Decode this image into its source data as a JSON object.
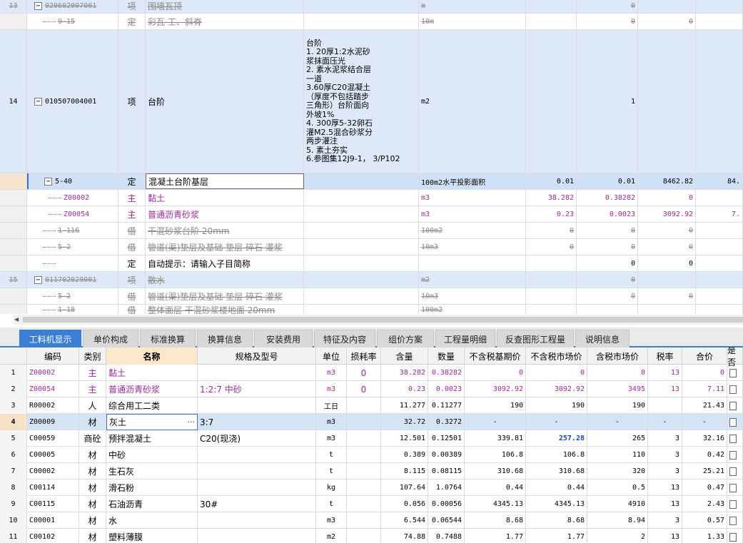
{
  "top_rows": [
    {
      "rownum": "13",
      "code": "020602007001",
      "type": "项",
      "name": "围墙瓦顶",
      "desc": "",
      "unit": "m",
      "q1": "",
      "q2": "0",
      "price": "",
      "total": "",
      "style": "strike",
      "bg": "blue",
      "toggle": "minus",
      "indent": 0
    },
    {
      "rownum": "",
      "code": "9-15",
      "type": "定",
      "name": "彩瓦 工、斜脊",
      "desc": "",
      "unit": "10m",
      "q1": "",
      "q2": "0",
      "price": "0",
      "total": "",
      "style": "strike",
      "bg": "white",
      "toggle": "none",
      "indent": 1
    },
    {
      "rownum": "14",
      "code": "010507004001",
      "type": "项",
      "name": "台阶",
      "desc": "台阶\n1. 20厚1:2水泥砂\n浆抹面压光\n2. 素水泥浆结合层\n一道\n3.60厚C20混凝土\n（厚度不包括踏步\n三角形）台阶面向\n外坡1%\n4. 300厚5-32卵石\n灌M2.5混合砂浆分\n两步灌注\n5. 素土夯实\n6.参图集12J9-1， 3/P102",
      "unit": "m2",
      "q1": "",
      "q2": "1",
      "price": "",
      "total": "",
      "style": "normal",
      "bg": "blue",
      "toggle": "minus",
      "indent": 0
    },
    {
      "rownum": "",
      "code": "5-40",
      "type": "定",
      "name": "混凝土台阶基层",
      "desc": "",
      "unit": "100m2水平投影面积",
      "q1": "0.01",
      "q2": "0.01",
      "price": "8462.82",
      "total": "84.",
      "style": "normal",
      "bg": "sel",
      "toggle": "minus",
      "indent": 1
    },
    {
      "rownum": "",
      "code": "Z00002",
      "type": "主",
      "name": "黏土",
      "desc": "",
      "unit": "m3",
      "q1": "38.282",
      "q2": "0.38282",
      "price": "0",
      "total": "",
      "style": "purple",
      "bg": "white",
      "toggle": "none",
      "indent": 2
    },
    {
      "rownum": "",
      "code": "Z00054",
      "type": "主",
      "name": "普通沥青砂浆",
      "desc": "",
      "unit": "m3",
      "q1": "0.23",
      "q2": "0.0023",
      "price": "3092.92",
      "total": "7.",
      "style": "purple",
      "bg": "white",
      "toggle": "none",
      "indent": 2
    },
    {
      "rownum": "",
      "code": "1-116",
      "type": "借",
      "name": "干混砂浆台阶 20mm",
      "desc": "",
      "unit": "100m2",
      "q1": "0",
      "q2": "0",
      "price": "0",
      "total": "",
      "style": "strike",
      "bg": "white",
      "toggle": "none",
      "indent": 1
    },
    {
      "rownum": "",
      "code": "5-2",
      "type": "借",
      "name": "管道(渠)垫层及基础 垫层 碎石 灌浆",
      "desc": "",
      "unit": "10m3",
      "q1": "0",
      "q2": "0",
      "price": "0",
      "total": "",
      "style": "strike",
      "bg": "white",
      "toggle": "none",
      "indent": 1
    },
    {
      "rownum": "",
      "code": "",
      "type": "定",
      "name": "自动提示：请输入子目简称",
      "desc": "",
      "unit": "",
      "q1": "",
      "q2": "0",
      "price": "0",
      "total": "",
      "style": "normal",
      "bg": "white",
      "toggle": "none",
      "indent": 1
    },
    {
      "rownum": "15",
      "code": "011702029001",
      "type": "项",
      "name": "散水",
      "desc": "",
      "unit": "m2",
      "q1": "",
      "q2": "0",
      "price": "",
      "total": "",
      "style": "strike",
      "bg": "blue",
      "toggle": "minus",
      "indent": 0
    },
    {
      "rownum": "",
      "code": "5-2",
      "type": "借",
      "name": "管道(渠)垫层及基础 垫层 碎石 灌浆",
      "desc": "",
      "unit": "10m3",
      "q1": "",
      "q2": "0",
      "price": "0",
      "total": "",
      "style": "strike",
      "bg": "white",
      "toggle": "none",
      "indent": 1
    },
    {
      "rownum": "",
      "code": "1-18",
      "type": "借",
      "name": "整体面层 干混砂浆楼地面 20mm",
      "desc": "",
      "unit": "100m2",
      "q1": "",
      "q2": "",
      "price": "",
      "total": "",
      "style": "strike",
      "bg": "white",
      "toggle": "none",
      "indent": 1
    }
  ],
  "tabs": [
    "工料机显示",
    "单价构成",
    "标准换算",
    "换算信息",
    "安装费用",
    "特征及内容",
    "组价方案",
    "工程量明细",
    "反查图形工程量",
    "说明信息"
  ],
  "active_tab": 0,
  "bottom_headers": [
    "",
    "编码",
    "类别",
    "名称",
    "规格及型号",
    "单位",
    "损耗率",
    "含量",
    "数量",
    "不含税基期价",
    "不含税市场价",
    "含税市场价",
    "税率",
    "合价",
    "是否"
  ],
  "bottom_rows": [
    {
      "n": "1",
      "code": "Z00002",
      "cat": "主",
      "name": "黏土",
      "spec": "",
      "unit": "m3",
      "loss": "0",
      "content": "38.282",
      "qty": "0.38282",
      "base": "0",
      "market": "0",
      "tax_market": "0",
      "rate": "13",
      "total": "0",
      "style": "purple"
    },
    {
      "n": "2",
      "code": "Z00054",
      "cat": "主",
      "name": "普通沥青砂浆",
      "spec": "1:2:7 中砂",
      "unit": "m3",
      "loss": "0",
      "content": "0.23",
      "qty": "0.0023",
      "base": "3092.92",
      "market": "3092.92",
      "tax_market": "3495",
      "rate": "13",
      "total": "7.11",
      "style": "purple"
    },
    {
      "n": "3",
      "code": "R00002",
      "cat": "人",
      "name": "综合用工二类",
      "spec": "",
      "unit": "工日",
      "loss": "",
      "content": "11.277",
      "qty": "0.11277",
      "base": "190",
      "market": "190",
      "tax_market": "190",
      "rate": "",
      "total": "21.43",
      "style": "normal"
    },
    {
      "n": "4",
      "code": "Z00009",
      "cat": "材",
      "name": "灰土",
      "spec": "3:7",
      "unit": "m3",
      "loss": "",
      "content": "32.72",
      "qty": "0.3272",
      "base": "-",
      "market": "-",
      "tax_market": "-",
      "rate": "-",
      "total": "-",
      "style": "sel"
    },
    {
      "n": "5",
      "code": "C00059",
      "cat": "商砼",
      "name": "预拌混凝土",
      "spec": "C20(现浇)",
      "unit": "m3",
      "loss": "",
      "content": "12.501",
      "qty": "0.12501",
      "base": "339.81",
      "market": "257.28",
      "tax_market": "265",
      "rate": "3",
      "total": "32.16",
      "style": "market-bold"
    },
    {
      "n": "6",
      "code": "C00005",
      "cat": "材",
      "name": "中砂",
      "spec": "",
      "unit": "t",
      "loss": "",
      "content": "0.389",
      "qty": "0.00389",
      "base": "106.8",
      "market": "106.8",
      "tax_market": "110",
      "rate": "3",
      "total": "0.42",
      "style": "normal"
    },
    {
      "n": "7",
      "code": "C00002",
      "cat": "材",
      "name": "生石灰",
      "spec": "",
      "unit": "t",
      "loss": "",
      "content": "8.115",
      "qty": "0.08115",
      "base": "310.68",
      "market": "310.68",
      "tax_market": "320",
      "rate": "3",
      "total": "25.21",
      "style": "normal"
    },
    {
      "n": "8",
      "code": "C00114",
      "cat": "材",
      "name": "滑石粉",
      "spec": "",
      "unit": "kg",
      "loss": "",
      "content": "107.64",
      "qty": "1.0764",
      "base": "0.44",
      "market": "0.44",
      "tax_market": "0.5",
      "rate": "13",
      "total": "0.47",
      "style": "normal"
    },
    {
      "n": "9",
      "code": "C00115",
      "cat": "材",
      "name": "石油沥青",
      "spec": "30#",
      "unit": "t",
      "loss": "",
      "content": "0.056",
      "qty": "0.00056",
      "base": "4345.13",
      "market": "4345.13",
      "tax_market": "4910",
      "rate": "13",
      "total": "2.43",
      "style": "normal"
    },
    {
      "n": "10",
      "code": "C00001",
      "cat": "材",
      "name": "水",
      "spec": "",
      "unit": "m3",
      "loss": "",
      "content": "6.544",
      "qty": "0.06544",
      "base": "8.68",
      "market": "8.68",
      "tax_market": "8.94",
      "rate": "3",
      "total": "0.57",
      "style": "normal"
    },
    {
      "n": "11",
      "code": "C00102",
      "cat": "材",
      "name": "塑料薄膜",
      "spec": "",
      "unit": "m2",
      "loss": "",
      "content": "74.88",
      "qty": "0.7488",
      "base": "1.77",
      "market": "1.77",
      "tax_market": "2",
      "rate": "13",
      "total": "1.33",
      "style": "normal"
    }
  ],
  "ellipsis": "···",
  "colors": {
    "accent": "#3a7fd5",
    "purple": "#9b2a9b",
    "blue_row": "#dde8f8",
    "selected_row": "#cfe0f7"
  }
}
